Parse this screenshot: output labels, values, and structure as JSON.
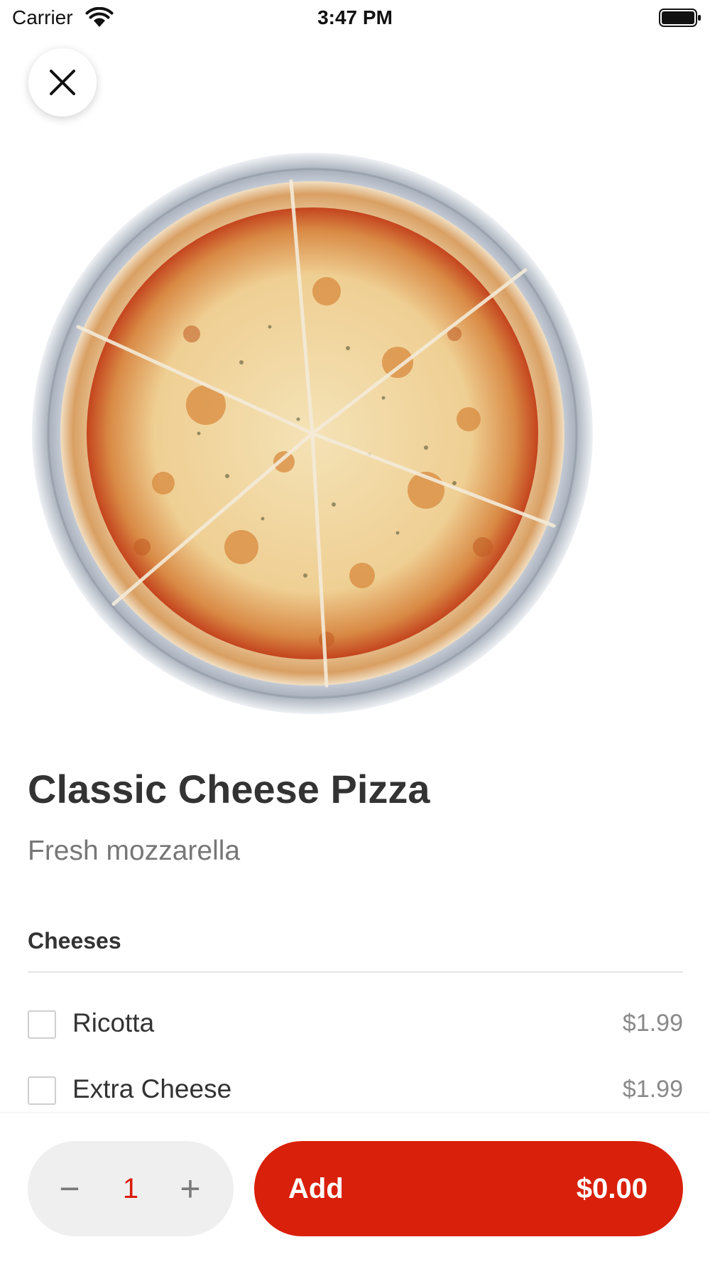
{
  "status_bar": {
    "carrier": "Carrier",
    "time": "3:47 PM",
    "icons": [
      "wifi-icon",
      "battery-icon"
    ]
  },
  "close_button": {
    "icon": "close-icon"
  },
  "hero_image": {
    "description_icon": "pizza-photo"
  },
  "product": {
    "title": "Classic Cheese Pizza",
    "description": "Fresh mozzarella"
  },
  "options_section": {
    "title": "Cheeses",
    "options": [
      {
        "name": "Ricotta",
        "price": "$1.99",
        "checked": false
      },
      {
        "name": "Extra Cheese",
        "price": "$1.99",
        "checked": false
      }
    ]
  },
  "bottom_bar": {
    "quantity": "1",
    "minus_label": "−",
    "plus_label": "+",
    "add_label": "Add",
    "add_price": "$0.00"
  },
  "colors": {
    "accent": "#d9200a",
    "quantity_text": "#d91c0a",
    "stepper_bg": "#efefef"
  }
}
